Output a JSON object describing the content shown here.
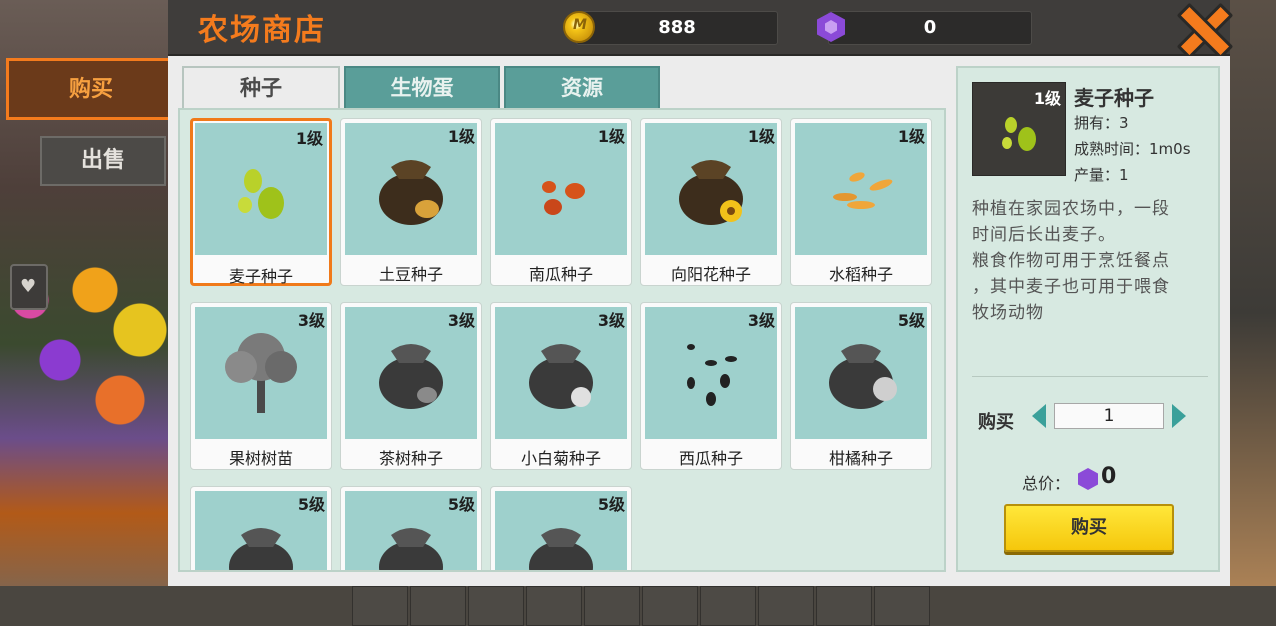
{
  "header": {
    "title": "农场商店",
    "coins": "888",
    "gems": "0"
  },
  "side_tabs": {
    "buy": "购买",
    "sell": "出售"
  },
  "category_tabs": [
    "种子",
    "生物蛋",
    "资源"
  ],
  "items": [
    {
      "level": "1级",
      "name": "麦子种子",
      "icon": "wheat-seeds"
    },
    {
      "level": "1级",
      "name": "土豆种子",
      "icon": "seed-bag"
    },
    {
      "level": "1级",
      "name": "南瓜种子",
      "icon": "pumpkin-seeds"
    },
    {
      "level": "1级",
      "name": "向阳花种子",
      "icon": "seed-bag-sunflower"
    },
    {
      "level": "1级",
      "name": "水稻种子",
      "icon": "rice-seeds"
    },
    {
      "level": "3级",
      "name": "果树树苗",
      "icon": "fruit-tree"
    },
    {
      "level": "3级",
      "name": "茶树种子",
      "icon": "seed-bag-locked"
    },
    {
      "level": "3级",
      "name": "小白菊种子",
      "icon": "seed-bag-locked"
    },
    {
      "level": "3级",
      "name": "西瓜种子",
      "icon": "watermelon-seeds"
    },
    {
      "level": "5级",
      "name": "柑橘种子",
      "icon": "seed-bag-locked"
    },
    {
      "level": "5级",
      "name": "",
      "icon": "seed-bag-locked"
    },
    {
      "level": "5级",
      "name": "",
      "icon": "seed-bag-locked"
    },
    {
      "level": "5级",
      "name": "",
      "icon": "seed-bag-locked"
    }
  ],
  "detail": {
    "level": "1级",
    "title": "麦子种子",
    "owned": "拥有：3",
    "mature_time_label": "成熟时间：",
    "mature_time": "1m0s",
    "yield": "产量：1",
    "desc_lines": [
      "种植在家园农场中，一段",
      "时间后长出麦子。",
      "粮食作物可用于烹饪餐点",
      "，其中麦子也可用于喂食",
      "牧场动物"
    ],
    "qty_label": "购买",
    "qty_value": "1",
    "total_label": "总价：",
    "total_value": "0",
    "buy_button": "购买"
  },
  "colors": {
    "accent": "#f47b1d",
    "tab_teal": "#5a9e99",
    "card_bg": "#9ed0cc",
    "buy_button": "#f5c70c"
  }
}
